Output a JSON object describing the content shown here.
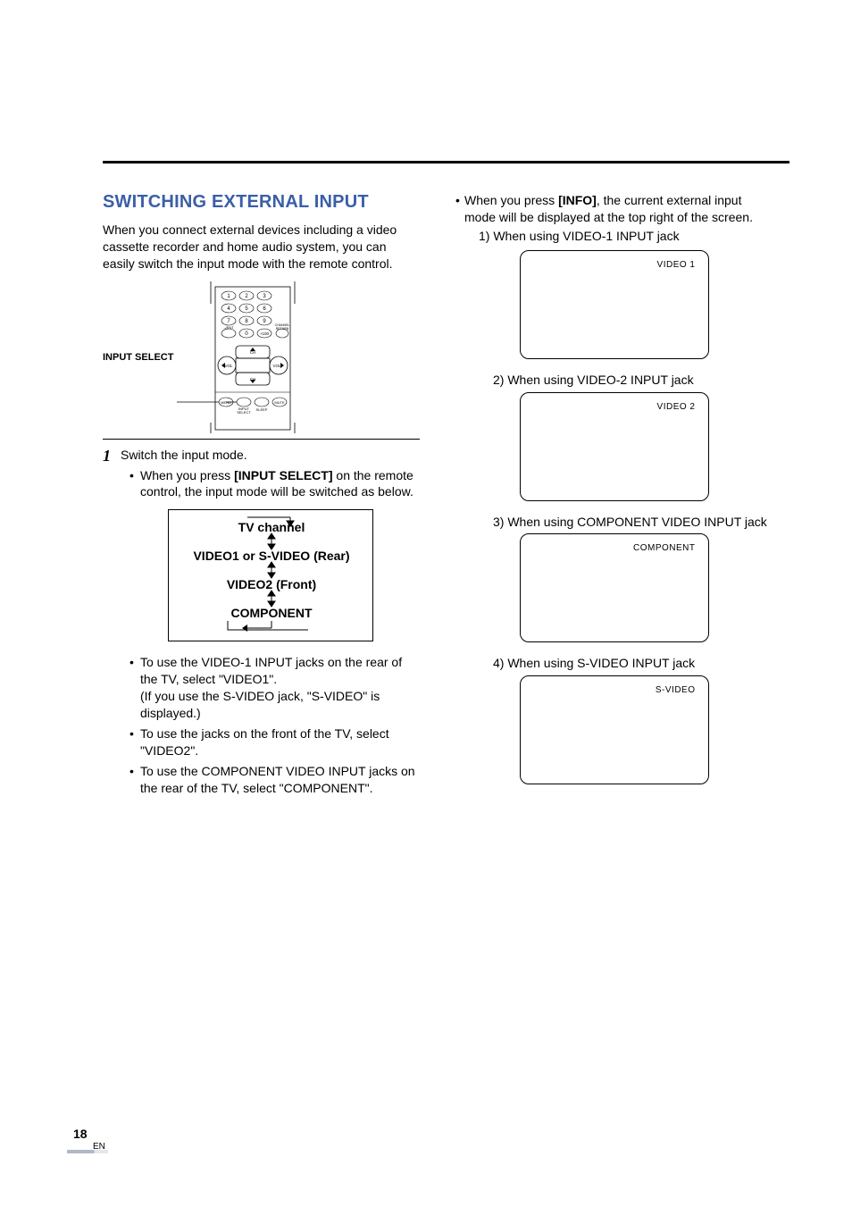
{
  "section_title": "SWITCHING EXTERNAL INPUT",
  "intro": "When you connect external devices including a video cassette recorder and home audio system, you can easily switch the input mode with the remote control.",
  "remote": {
    "callout_label": "INPUT SELECT",
    "numpad": [
      "1",
      "2",
      "3",
      "4",
      "5",
      "6",
      "7",
      "8",
      "9",
      "0"
    ],
    "btn_plus100": "+100",
    "btn_dash_ent": "–/ENT",
    "btn_channel_return": "CHANNEL RETURN",
    "btn_ch_up": "CH",
    "btn_ch_dn": "CH",
    "btn_vol_left": "VOL",
    "btn_vol_right": "VOL",
    "row_labels": {
      "menu": "MENU",
      "input_select": "INPUT SELECT",
      "sleep": "SLEEP",
      "mute": "MUTE"
    }
  },
  "step_num": "1",
  "step_text": "Switch the input mode.",
  "step_bullets": [
    {
      "pre": "When you press ",
      "bold": "[INPUT SELECT]",
      "post": " on the remote control, the input mode will be switched as below."
    }
  ],
  "flow": {
    "row1": "TV channel",
    "row2_main": "VIDEO1",
    "row2_mid": " or ",
    "row2_tail": "S-VIDEO (Rear)",
    "row3_main": "VIDEO2",
    "row3_tail": " (Front)",
    "row4": "COMPONENT"
  },
  "post_flow_bullets": [
    "To use the VIDEO-1 INPUT jacks on the rear of the TV, select \"VIDEO1\".\n(If you use the S-VIDEO jack, \"S-VIDEO\" is displayed.)",
    "To use the jacks on the front of the TV, select \"VIDEO2\".",
    "To use the COMPONENT VIDEO INPUT jacks on the rear of the TV, select \"COMPONENT\"."
  ],
  "right_lead_pre": "When you press ",
  "right_lead_bold": "[INFO]",
  "right_lead_post": ", the current external input mode will be displayed at the top right of the screen.",
  "screens": [
    {
      "caption": "1) When using VIDEO-1 INPUT jack",
      "label": "VIDEO 1"
    },
    {
      "caption": "2) When using VIDEO-2 INPUT jack",
      "label": "VIDEO 2"
    },
    {
      "caption": "3) When using COMPONENT VIDEO INPUT jack",
      "label": "COMPONENT"
    },
    {
      "caption": "4) When using S-VIDEO INPUT jack",
      "label": "S-VIDEO"
    }
  ],
  "page_number": "18",
  "page_lang": "EN"
}
